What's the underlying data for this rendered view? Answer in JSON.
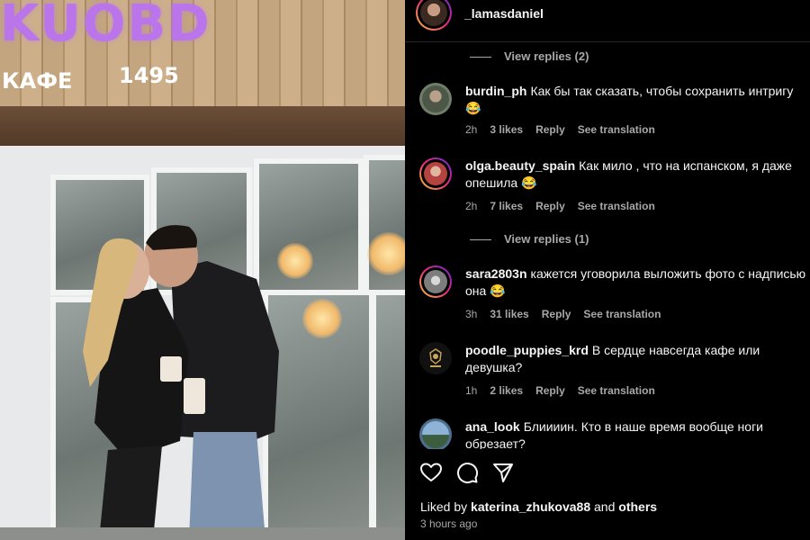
{
  "photo": {
    "sign": {
      "word": "KUOBD",
      "subtitle": "КАФЕ",
      "number": "1495"
    },
    "colors": {
      "sign": "#b975e9",
      "wood": "#c3a57f"
    }
  },
  "post": {
    "author": "_lamasdaniel"
  },
  "comments": [
    {
      "type": "view_replies",
      "label": "View replies (2)"
    },
    {
      "type": "comment",
      "username": "burdin_ph",
      "text": "Как бы так сказать, чтобы сохранить интригу 😂",
      "time": "2h",
      "likes": "3 likes",
      "reply": "Reply",
      "translate": "See translation",
      "avatar_color": "#6f7d6a",
      "ring": false
    },
    {
      "type": "comment",
      "username": "olga.beauty_spain",
      "text": "Как мило , что на испанском, я даже опешила 😂",
      "time": "2h",
      "likes": "7 likes",
      "reply": "Reply",
      "translate": "See translation",
      "avatar_color": "#b5433f",
      "ring": true
    },
    {
      "type": "view_replies",
      "label": "View replies (1)"
    },
    {
      "type": "comment",
      "username": "sara2803n",
      "text": "кажется уговорила выложить фото с надписью она 😂",
      "time": "3h",
      "likes": "31 likes",
      "reply": "Reply",
      "translate": "See translation",
      "avatar_color": "#8d8d8d",
      "ring": true
    },
    {
      "type": "comment",
      "username": "poodle_puppies_krd",
      "text": "В сердце навсегда кафе или девушка?",
      "time": "1h",
      "likes": "2 likes",
      "reply": "Reply",
      "translate": "See translation",
      "avatar_color": "#1a1a1a",
      "ring": false
    },
    {
      "type": "comment",
      "username": "ana_look",
      "text": "Блиииин. Кто в наше время вообще ноги обрезает?",
      "time": "",
      "likes": "",
      "reply": "",
      "translate": "",
      "avatar_color": "#4d6f8f",
      "ring": false
    }
  ],
  "actions": {
    "like_icon": "heart-icon",
    "comment_icon": "comment-icon",
    "share_icon": "share-icon"
  },
  "likes": {
    "prefix": "Liked by",
    "user": "katerina_zhukova88",
    "connector": "and",
    "others": "others"
  },
  "timestamp": "3 hours ago",
  "colors": {
    "background": "#000000",
    "text": "#f5f5f5",
    "secondary": "#a8a8a8"
  }
}
